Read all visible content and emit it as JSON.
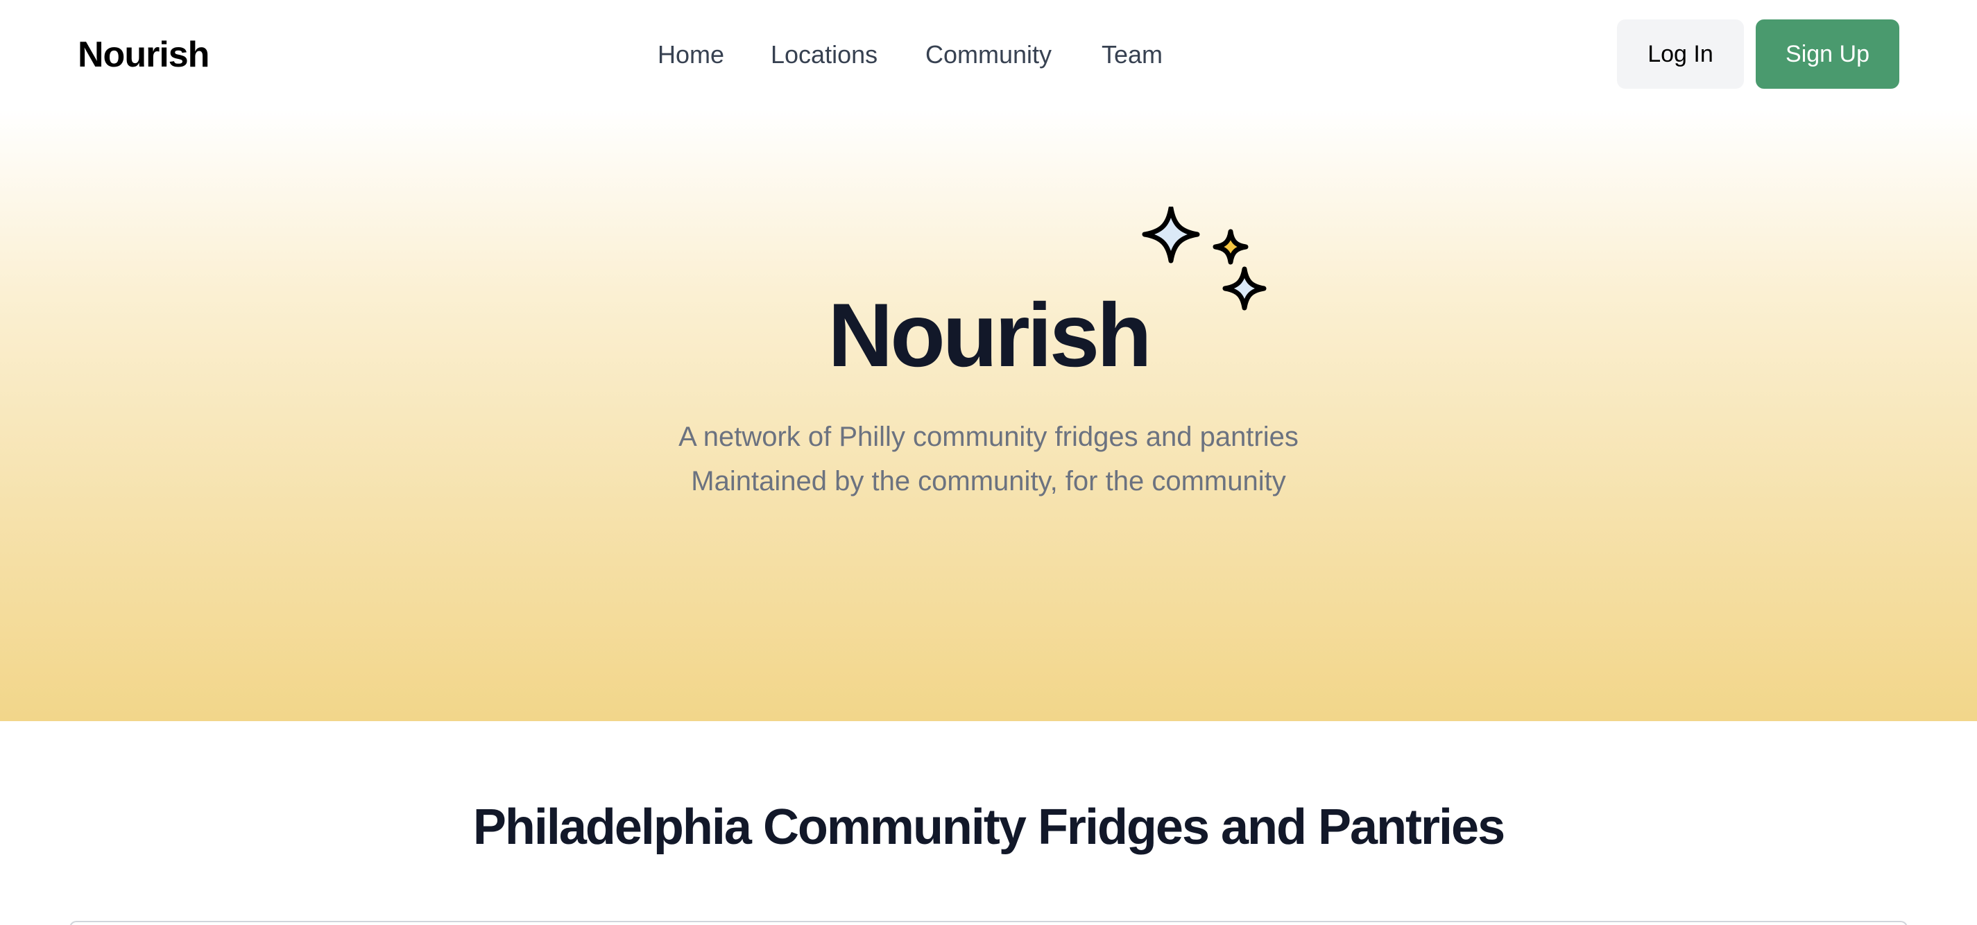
{
  "header": {
    "brand": "Nourish",
    "nav": {
      "home": "Home",
      "locations": "Locations",
      "community": "Community",
      "team": "Team"
    },
    "login_label": "Log In",
    "signup_label": "Sign Up"
  },
  "hero": {
    "title": "Nourish",
    "subtitle_line1": "A network of Philly community fridges and pantries",
    "subtitle_line2": "Maintained by the community, for the community"
  },
  "section": {
    "title": "Philadelphia Community Fridges and Pantries"
  },
  "icons": {
    "sparkle_large": "sparkle-icon",
    "sparkle_small": "sparkle-icon",
    "sparkle_medium": "sparkle-icon"
  },
  "colors": {
    "brand_green": "#4a9a6e",
    "hero_gold": "#f2d68a",
    "sparkle_gold": "#f4c542",
    "sparkle_blue": "#dbe9f7",
    "heading_dark": "#121829"
  }
}
